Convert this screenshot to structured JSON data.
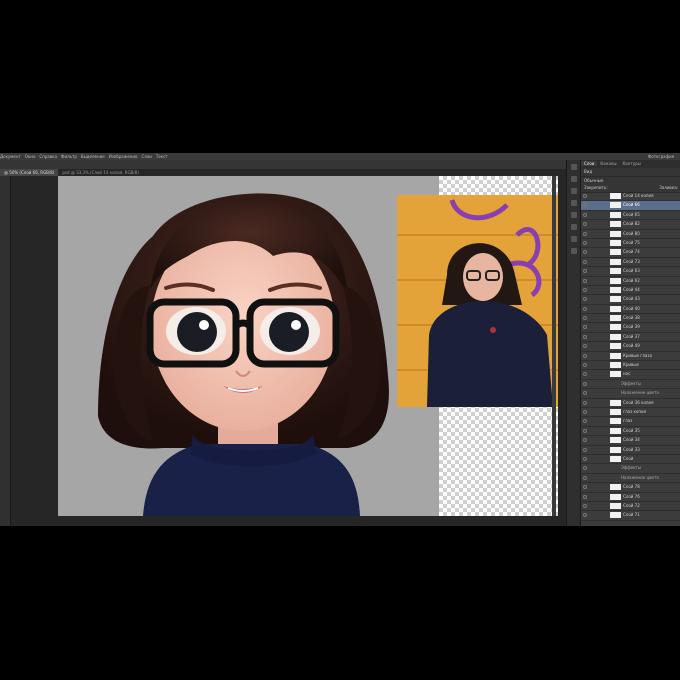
{
  "menubar": {
    "items": [
      "Документ",
      "Окно",
      "Справка",
      "Фильтр",
      "Выделение",
      "Изображение",
      "Слои",
      "Текст"
    ],
    "workspace": "Фотография"
  },
  "tabs": [
    {
      "label": "@ 50% (Слой 66, RGB/8)",
      "active": true
    },
    {
      "label": "psd @ 33,3% (Слой 14 копия, RGB/8)",
      "active": false
    }
  ],
  "panel": {
    "tabs": [
      "Слои",
      "Каналы",
      "Контуры"
    ],
    "kind_filter": "Вид",
    "blend_mode": "Обычные",
    "lock_label": "Закрепить:",
    "opacity_label": "Заливка:",
    "layers": [
      {
        "name": "Слой 14 копия",
        "type": "layer"
      },
      {
        "name": "Слой 66",
        "type": "layer",
        "selected": true
      },
      {
        "name": "Слой 65",
        "type": "layer"
      },
      {
        "name": "Слой 82",
        "type": "layer"
      },
      {
        "name": "Слой 80",
        "type": "layer"
      },
      {
        "name": "Слой 75",
        "type": "layer"
      },
      {
        "name": "Слой 74",
        "type": "layer"
      },
      {
        "name": "Слой 73",
        "type": "layer"
      },
      {
        "name": "Слой 63",
        "type": "layer"
      },
      {
        "name": "Слой 62",
        "type": "layer"
      },
      {
        "name": "Слой 44",
        "type": "layer"
      },
      {
        "name": "Слой 43",
        "type": "layer"
      },
      {
        "name": "Слой 40",
        "type": "layer"
      },
      {
        "name": "Слой 38",
        "type": "layer"
      },
      {
        "name": "Слой 39",
        "type": "layer"
      },
      {
        "name": "Слой 37",
        "type": "layer"
      },
      {
        "name": "Слой 49",
        "type": "layer"
      },
      {
        "name": "Кривые глаза",
        "type": "layer"
      },
      {
        "name": "Кривые",
        "type": "layer"
      },
      {
        "name": "нос",
        "type": "layer"
      },
      {
        "name": "Эффекты",
        "type": "fx"
      },
      {
        "name": "Наложение цвета",
        "type": "fx"
      },
      {
        "name": "Слой 36 копия",
        "type": "layer"
      },
      {
        "name": "глаз копия",
        "type": "layer"
      },
      {
        "name": "глаз",
        "type": "layer"
      },
      {
        "name": "Слой 35",
        "type": "layer"
      },
      {
        "name": "Слой 34",
        "type": "layer"
      },
      {
        "name": "Слой 33",
        "type": "layer"
      },
      {
        "name": "Слой",
        "type": "layer"
      },
      {
        "name": "Эффекты",
        "type": "fx"
      },
      {
        "name": "Наложение цвета",
        "type": "fx"
      },
      {
        "name": "Слой 78",
        "type": "layer"
      },
      {
        "name": "Слой 76",
        "type": "layer"
      },
      {
        "name": "Слой 72",
        "type": "layer"
      },
      {
        "name": "Слой 71",
        "type": "layer"
      }
    ]
  },
  "colors": {
    "canvas_gray": "#a6a6a6",
    "photo_bg": "#e6a23a",
    "sweater": "#1a2148",
    "hair": "#2b1612",
    "skin": "#f2c4b4",
    "selection": "#5a6f8c"
  }
}
